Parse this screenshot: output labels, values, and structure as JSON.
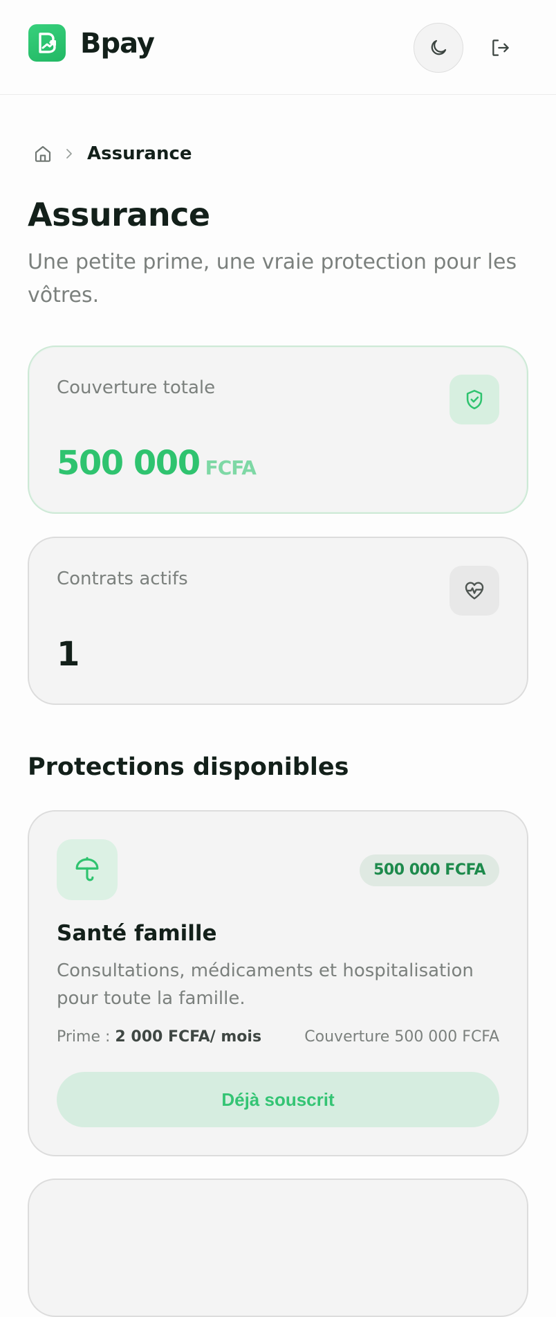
{
  "header": {
    "brand": "Bpay",
    "logo_icon": "bpay-logo-icon",
    "theme_icon": "moon-icon",
    "logout_icon": "logout-icon"
  },
  "breadcrumb": {
    "home_icon": "home-icon",
    "separator_icon": "chevron-right-icon",
    "current": "Assurance"
  },
  "page": {
    "title": "Assurance",
    "subtitle": "Une petite prime, une vraie protection pour les vôtres."
  },
  "stats": {
    "coverage": {
      "label": "Couverture totale",
      "value": "500 000",
      "currency": "FCFA",
      "icon": "shield-check-icon"
    },
    "contracts": {
      "label": "Contrats actifs",
      "value": "1",
      "icon": "heart-pulse-icon"
    }
  },
  "section": {
    "title": "Protections disponibles"
  },
  "products": [
    {
      "icon": "umbrella-icon",
      "badge": "500 000 FCFA",
      "name": "Santé famille",
      "description": "Consultations, médicaments et hospitalisation pour toute la famille.",
      "premium_label": "Prime :",
      "premium_value": "2 000 FCFA/ mois",
      "coverage_text": "Couverture 500 000 FCFA",
      "button_label": "Déjà souscrit"
    }
  ],
  "colors": {
    "accent": "#2fc36f",
    "accent_light": "#d7efe0",
    "text": "#13201a",
    "muted": "#7b807d",
    "card_bg": "#f4f4f4"
  }
}
